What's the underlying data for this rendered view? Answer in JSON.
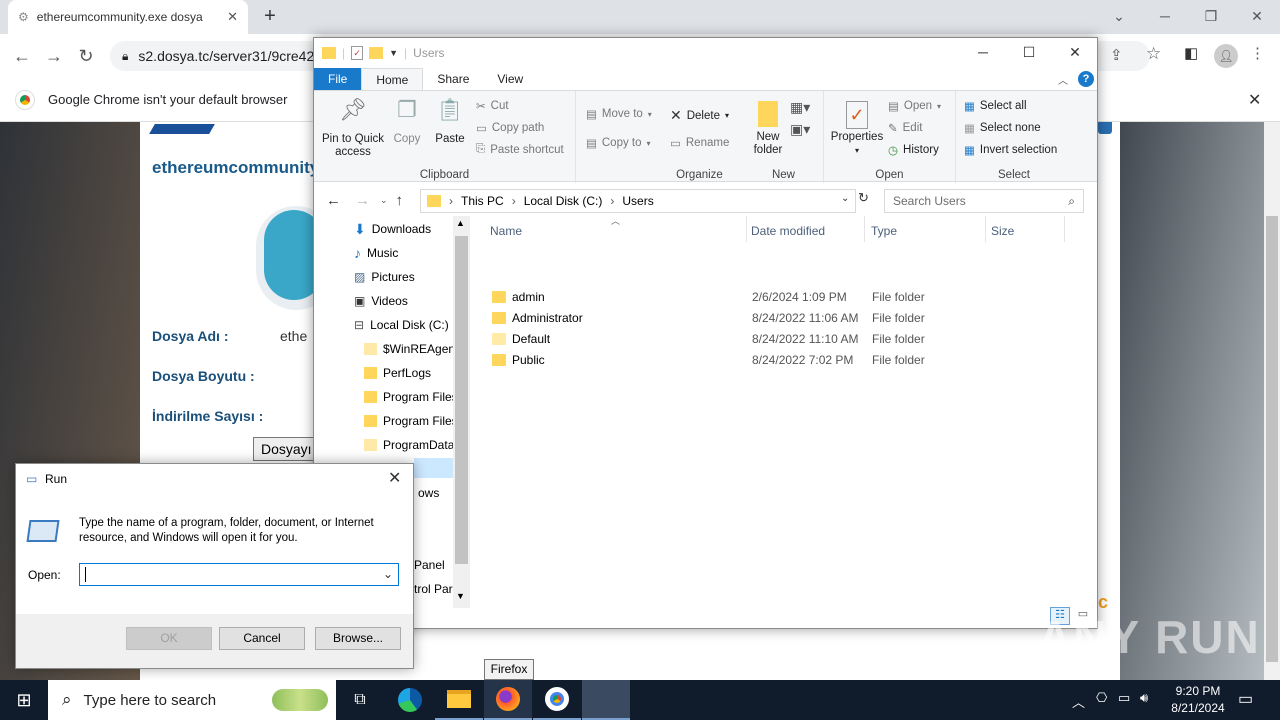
{
  "chrome": {
    "tab_title": "ethereumcommunity.exe dosya",
    "url": "s2.dosya.tc/server31/9cre42",
    "infobar_text": "Google Chrome isn't your default browser"
  },
  "webpage": {
    "heading": "ethereumcommunity",
    "label_filename": "Dosya Adı :",
    "value_filename": "ethe",
    "label_filesize": "Dosya Boyutu :",
    "label_downloads": "İndirilme Sayısı :",
    "download_button": "Dosyayı"
  },
  "explorer": {
    "title": "Users",
    "tabs": [
      "File",
      "Home",
      "Share",
      "View"
    ],
    "ribbon": {
      "clipboard": {
        "label": "Clipboard",
        "pin": "Pin to Quick access",
        "copy": "Copy",
        "paste": "Paste",
        "cut": "Cut",
        "copy_path": "Copy path",
        "paste_shortcut": "Paste shortcut"
      },
      "organize": {
        "label": "Organize",
        "move_to": "Move to",
        "copy_to": "Copy to",
        "delete": "Delete",
        "rename": "Rename"
      },
      "new": {
        "label": "New",
        "new_folder": "New folder"
      },
      "open": {
        "label": "Open",
        "properties": "Properties",
        "open": "Open",
        "edit": "Edit",
        "history": "History"
      },
      "select": {
        "label": "Select",
        "select_all": "Select all",
        "select_none": "Select none",
        "invert": "Invert selection"
      }
    },
    "breadcrumb": [
      "This PC",
      "Local Disk (C:)",
      "Users"
    ],
    "search_placeholder": "Search Users",
    "nav_items": [
      "Downloads",
      "Music",
      "Pictures",
      "Videos",
      "Local Disk (C:)",
      "$WinREAgent",
      "PerfLogs",
      "Program Files",
      "Program Files",
      "ProgramData",
      "",
      "ows",
      "",
      "",
      "Panel",
      "trol Par"
    ],
    "columns": {
      "name": "Name",
      "date": "Date modified",
      "type": "Type",
      "size": "Size"
    },
    "files": [
      {
        "name": "admin",
        "date": "2/6/2024 1:09 PM",
        "type": "File folder"
      },
      {
        "name": "Administrator",
        "date": "8/24/2022 11:06 AM",
        "type": "File folder"
      },
      {
        "name": "Default",
        "date": "8/24/2022 11:10 AM",
        "type": "File folder"
      },
      {
        "name": "Public",
        "date": "8/24/2022 7:02 PM",
        "type": "File folder"
      }
    ]
  },
  "run_dialog": {
    "title": "Run",
    "description": "Type the name of a program, folder, document, or Internet resource, and Windows will open it for you.",
    "open_label": "Open:",
    "open_value": "",
    "ok": "OK",
    "cancel": "Cancel",
    "browse": "Browse..."
  },
  "taskbar": {
    "search_placeholder": "Type here to search",
    "tooltip": "Firefox",
    "time": "9:20 PM",
    "date": "8/21/2024"
  },
  "watermark": "ANY RUN"
}
